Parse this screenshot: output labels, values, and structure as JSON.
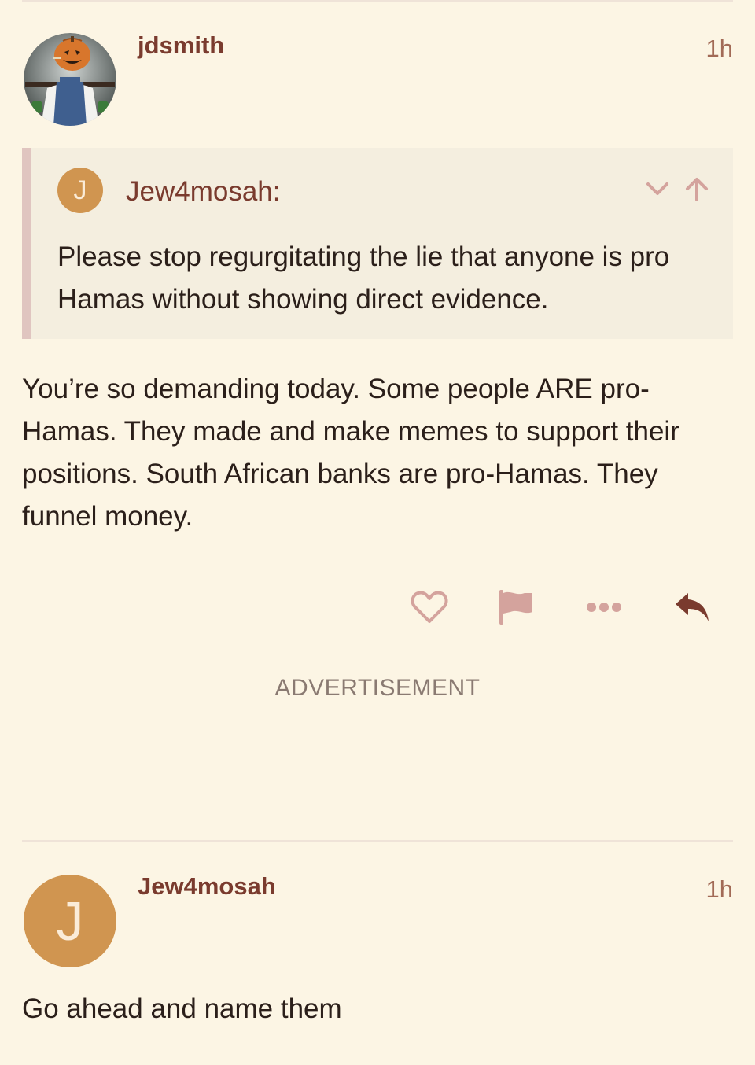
{
  "posts": [
    {
      "username": "jdsmith",
      "time": "1h",
      "quote": {
        "avatar_letter": "J",
        "author": "Jew4mosah:",
        "text": "Please stop regurgitating the lie that anyone is pro Hamas without showing direct evidence."
      },
      "body": "You’re so demanding today. Some people ARE pro-Hamas. They made and make memes to support their positions. South African banks are pro-Hamas. They funnel money.",
      "actions": [
        "heart-icon",
        "flag-icon",
        "more-icon",
        "reply-icon"
      ]
    },
    {
      "username": "Jew4mosah",
      "time": "1h",
      "avatar_letter": "J",
      "body": "Go ahead and name them"
    }
  ],
  "advertisement_label": "ADVERTISEMENT",
  "colors": {
    "background": "#fcf5e4",
    "username": "#7a3b2e",
    "avatar_orange": "#d09550",
    "quote_border": "#e0c5c0",
    "icon_pink": "#d4a39d",
    "reply_icon": "#7a3b2e"
  }
}
